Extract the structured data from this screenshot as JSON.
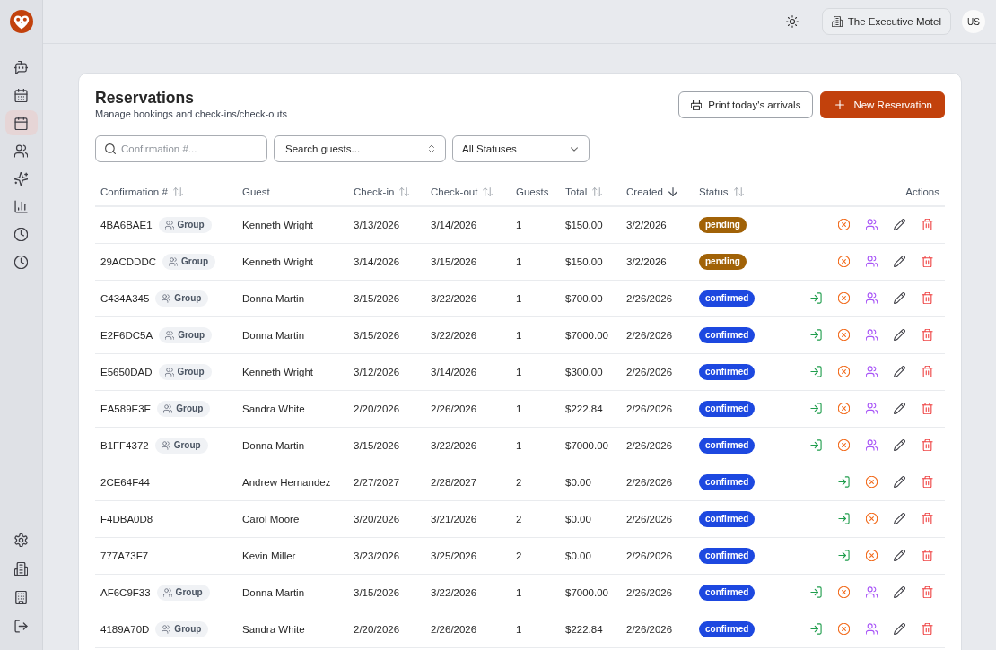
{
  "sidebar": {
    "items": [
      {
        "selected": false
      },
      {
        "selected": false
      },
      {
        "selected": true
      },
      {
        "selected": false
      },
      {
        "selected": false
      },
      {
        "selected": false
      },
      {
        "selected": false
      },
      {
        "selected": false
      }
    ],
    "bottom_items": [
      {
        "selected": false
      },
      {
        "selected": false
      },
      {
        "selected": false
      },
      {
        "selected": false
      }
    ]
  },
  "top_bar": {
    "hotel": "The Executive Motel",
    "avatar": "US"
  },
  "header": {
    "title": "Reservations",
    "subtitle": "Manage bookings and check-ins/check-outs",
    "buttons": [
      {
        "label": "Print today's arrivals",
        "kind": "print"
      },
      {
        "label": "New Reservation",
        "kind": "create"
      }
    ]
  },
  "filters": [
    {
      "kind": "search",
      "placeholder": "Confirmation #..."
    },
    {
      "kind": "combobox",
      "label": "Search guests..."
    },
    {
      "kind": "select",
      "label": "All Statuses"
    }
  ],
  "table": {
    "columns": [
      {
        "label": "Confirmation #",
        "sortable": true,
        "sorted": false
      },
      {
        "label": "Guest"
      },
      {
        "label": "Check-in",
        "sortable": true,
        "sorted": false
      },
      {
        "label": "Check-out",
        "sortable": true,
        "sorted": false
      },
      {
        "label": "Guests"
      },
      {
        "label": "Total",
        "sortable": true,
        "sorted": false
      },
      {
        "label": "Created",
        "sortable": true,
        "sorted": true,
        "descending": true
      },
      {
        "label": "Status",
        "sortable": true,
        "sorted": false
      },
      {
        "label": "Actions"
      }
    ],
    "rows": [
      {
        "confirmation": "4BA6BAE1",
        "badge": "Group",
        "guest": "Kenneth Wright",
        "check_in": "3/13/2026",
        "check_out": "3/14/2026",
        "guests": "1",
        "total": "$150.00",
        "created": "3/2/2026",
        "status": {
          "label": "pending",
          "color": "#a16207"
        },
        "actions": [
          {
            "kind": "cancel"
          },
          {
            "kind": "group"
          },
          {
            "kind": "edit"
          },
          {
            "kind": "delete"
          }
        ]
      },
      {
        "confirmation": "29ACDDDC",
        "badge": "Group",
        "guest": "Kenneth Wright",
        "check_in": "3/14/2026",
        "check_out": "3/15/2026",
        "guests": "1",
        "total": "$150.00",
        "created": "3/2/2026",
        "status": {
          "label": "pending",
          "color": "#a16207"
        },
        "actions": [
          {
            "kind": "cancel"
          },
          {
            "kind": "group"
          },
          {
            "kind": "edit"
          },
          {
            "kind": "delete"
          }
        ]
      },
      {
        "confirmation": "C434A345",
        "badge": "Group",
        "guest": "Donna Martin",
        "check_in": "3/15/2026",
        "check_out": "3/22/2026",
        "guests": "1",
        "total": "$700.00",
        "created": "2/26/2026",
        "status": {
          "label": "confirmed",
          "color": "#1d48e0"
        },
        "actions": [
          {
            "kind": "check-in"
          },
          {
            "kind": "cancel"
          },
          {
            "kind": "group"
          },
          {
            "kind": "edit"
          },
          {
            "kind": "delete"
          }
        ]
      },
      {
        "confirmation": "E2F6DC5A",
        "badge": "Group",
        "guest": "Donna Martin",
        "check_in": "3/15/2026",
        "check_out": "3/22/2026",
        "guests": "1",
        "total": "$7000.00",
        "created": "2/26/2026",
        "status": {
          "label": "confirmed",
          "color": "#1d48e0"
        },
        "actions": [
          {
            "kind": "check-in"
          },
          {
            "kind": "cancel"
          },
          {
            "kind": "group"
          },
          {
            "kind": "edit"
          },
          {
            "kind": "delete"
          }
        ]
      },
      {
        "confirmation": "E5650DAD",
        "badge": "Group",
        "guest": "Kenneth Wright",
        "check_in": "3/12/2026",
        "check_out": "3/14/2026",
        "guests": "1",
        "total": "$300.00",
        "created": "2/26/2026",
        "status": {
          "label": "confirmed",
          "color": "#1d48e0"
        },
        "actions": [
          {
            "kind": "check-in"
          },
          {
            "kind": "cancel"
          },
          {
            "kind": "group"
          },
          {
            "kind": "edit"
          },
          {
            "kind": "delete"
          }
        ]
      },
      {
        "confirmation": "EA589E3E",
        "badge": "Group",
        "guest": "Sandra White",
        "check_in": "2/20/2026",
        "check_out": "2/26/2026",
        "guests": "1",
        "total": "$222.84",
        "created": "2/26/2026",
        "status": {
          "label": "confirmed",
          "color": "#1d48e0"
        },
        "actions": [
          {
            "kind": "check-in"
          },
          {
            "kind": "cancel"
          },
          {
            "kind": "group"
          },
          {
            "kind": "edit"
          },
          {
            "kind": "delete"
          }
        ]
      },
      {
        "confirmation": "B1FF4372",
        "badge": "Group",
        "guest": "Donna Martin",
        "check_in": "3/15/2026",
        "check_out": "3/22/2026",
        "guests": "1",
        "total": "$7000.00",
        "created": "2/26/2026",
        "status": {
          "label": "confirmed",
          "color": "#1d48e0"
        },
        "actions": [
          {
            "kind": "check-in"
          },
          {
            "kind": "cancel"
          },
          {
            "kind": "group"
          },
          {
            "kind": "edit"
          },
          {
            "kind": "delete"
          }
        ]
      },
      {
        "confirmation": "2CE64F44",
        "guest": "Andrew Hernandez",
        "check_in": "2/27/2027",
        "check_out": "2/28/2027",
        "guests": "2",
        "total": "$0.00",
        "created": "2/26/2026",
        "status": {
          "label": "confirmed",
          "color": "#1d48e0"
        },
        "actions": [
          {
            "kind": "check-in"
          },
          {
            "kind": "cancel"
          },
          {
            "kind": "edit"
          },
          {
            "kind": "delete"
          }
        ]
      },
      {
        "confirmation": "F4DBA0D8",
        "guest": "Carol Moore",
        "check_in": "3/20/2026",
        "check_out": "3/21/2026",
        "guests": "2",
        "total": "$0.00",
        "created": "2/26/2026",
        "status": {
          "label": "confirmed",
          "color": "#1d48e0"
        },
        "actions": [
          {
            "kind": "check-in"
          },
          {
            "kind": "cancel"
          },
          {
            "kind": "edit"
          },
          {
            "kind": "delete"
          }
        ]
      },
      {
        "confirmation": "777A73F7",
        "guest": "Kevin Miller",
        "check_in": "3/23/2026",
        "check_out": "3/25/2026",
        "guests": "2",
        "total": "$0.00",
        "created": "2/26/2026",
        "status": {
          "label": "confirmed",
          "color": "#1d48e0"
        },
        "actions": [
          {
            "kind": "check-in"
          },
          {
            "kind": "cancel"
          },
          {
            "kind": "edit"
          },
          {
            "kind": "delete"
          }
        ]
      },
      {
        "confirmation": "AF6C9F33",
        "badge": "Group",
        "guest": "Donna Martin",
        "check_in": "3/15/2026",
        "check_out": "3/22/2026",
        "guests": "1",
        "total": "$7000.00",
        "created": "2/26/2026",
        "status": {
          "label": "confirmed",
          "color": "#1d48e0"
        },
        "actions": [
          {
            "kind": "check-in"
          },
          {
            "kind": "cancel"
          },
          {
            "kind": "group"
          },
          {
            "kind": "edit"
          },
          {
            "kind": "delete"
          }
        ]
      },
      {
        "confirmation": "4189A70D",
        "badge": "Group",
        "guest": "Sandra White",
        "check_in": "2/20/2026",
        "check_out": "2/26/2026",
        "guests": "1",
        "total": "$222.84",
        "created": "2/26/2026",
        "status": {
          "label": "confirmed",
          "color": "#1d48e0"
        },
        "actions": [
          {
            "kind": "check-in"
          },
          {
            "kind": "cancel"
          },
          {
            "kind": "group"
          },
          {
            "kind": "edit"
          },
          {
            "kind": "delete"
          }
        ]
      }
    ]
  }
}
